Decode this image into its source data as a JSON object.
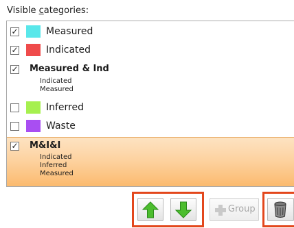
{
  "header": {
    "label_prefix": "Visible ",
    "label_accel": "c",
    "label_suffix": "ategories:"
  },
  "items": [
    {
      "label": "Measured",
      "checked": true,
      "color": "#59e7ea"
    },
    {
      "label": "Indicated",
      "checked": true,
      "color": "#ef4b4b"
    },
    {
      "label": "Measured & Ind",
      "checked": true,
      "members": [
        "Indicated",
        "Measured"
      ]
    },
    {
      "label": "Inferred",
      "checked": false,
      "color": "#a6f04f"
    },
    {
      "label": "Waste",
      "checked": false,
      "color": "#a94ef2"
    },
    {
      "label": "M&I&I",
      "checked": true,
      "selected": true,
      "members": [
        "Indicated",
        "Inferred",
        "Measured"
      ]
    }
  ],
  "toolbar": {
    "group_label": "Group"
  },
  "checkmark": "✓"
}
